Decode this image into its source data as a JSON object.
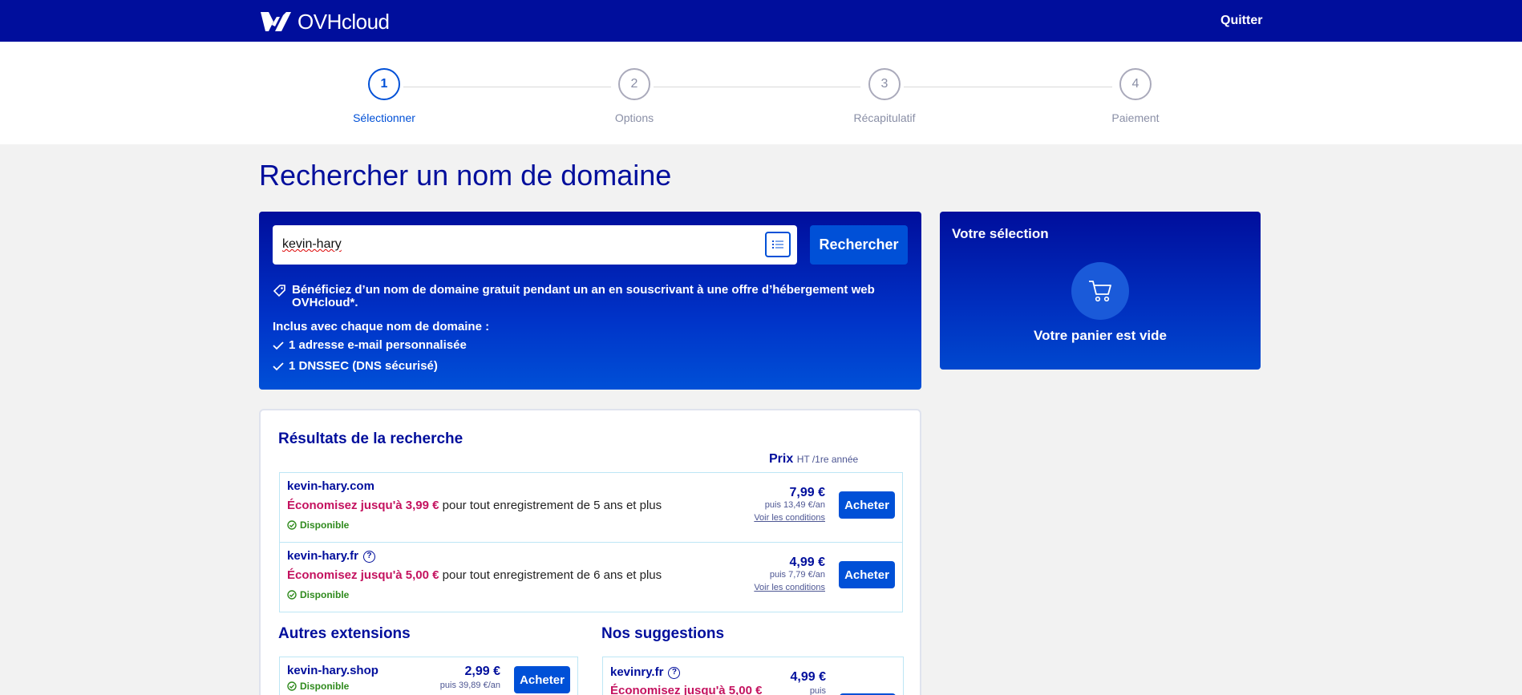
{
  "header": {
    "brand": "OVHcloud",
    "quit_label": "Quitter"
  },
  "stepper": {
    "steps": [
      {
        "num": "1",
        "label": "Sélectionner"
      },
      {
        "num": "2",
        "label": "Options"
      },
      {
        "num": "3",
        "label": "Récapitulatif"
      },
      {
        "num": "4",
        "label": "Paiement"
      }
    ]
  },
  "page": {
    "title": "Rechercher un nom de domaine"
  },
  "search": {
    "value": "kevin-hary",
    "button": "Rechercher",
    "promo": "Bénéficiez d’un nom de domaine gratuit pendant un an en souscrivant à une offre d’hébergement web OVHcloud*.",
    "included_title": "Inclus avec chaque nom de domaine :",
    "included": [
      "1 adresse e-mail personnalisée",
      "1 DNSSEC (DNS sécurisé)"
    ]
  },
  "cart": {
    "title": "Votre sélection",
    "empty": "Votre panier est vide"
  },
  "results": {
    "title": "Résultats de la recherche",
    "price_label": "Prix",
    "price_note": "HT /1re année",
    "rows": [
      {
        "domain": "kevin-hary.com",
        "save_bold": "Économisez jusqu'à 3,99 €",
        "save_rest": " pour tout enregistrement de 5 ans et plus",
        "status": "Disponible",
        "price": "7,99 €",
        "then": "puis 13,49 €/an",
        "conditions": "Voir les conditions",
        "buy": "Acheter"
      },
      {
        "domain": "kevin-hary.fr",
        "save_bold": "Économisez jusqu'à 5,00 €",
        "save_rest": " pour tout enregistrement de 6 ans et plus",
        "status": "Disponible",
        "price": "4,99 €",
        "then": "puis 7,79 €/an",
        "conditions": "Voir les conditions",
        "buy": "Acheter"
      }
    ],
    "other_title": "Autres extensions",
    "other": {
      "domain": "kevin-hary.shop",
      "status": "Disponible",
      "price": "2,99 €",
      "then": "puis 39,89 €/an",
      "buy": "Acheter"
    },
    "suggest_title": "Nos suggestions",
    "suggest": {
      "domain": "kevinry.fr",
      "save_bold": "Économisez jusqu'à 5,00 €",
      "price": "4,99 €",
      "then": "puis"
    }
  }
}
